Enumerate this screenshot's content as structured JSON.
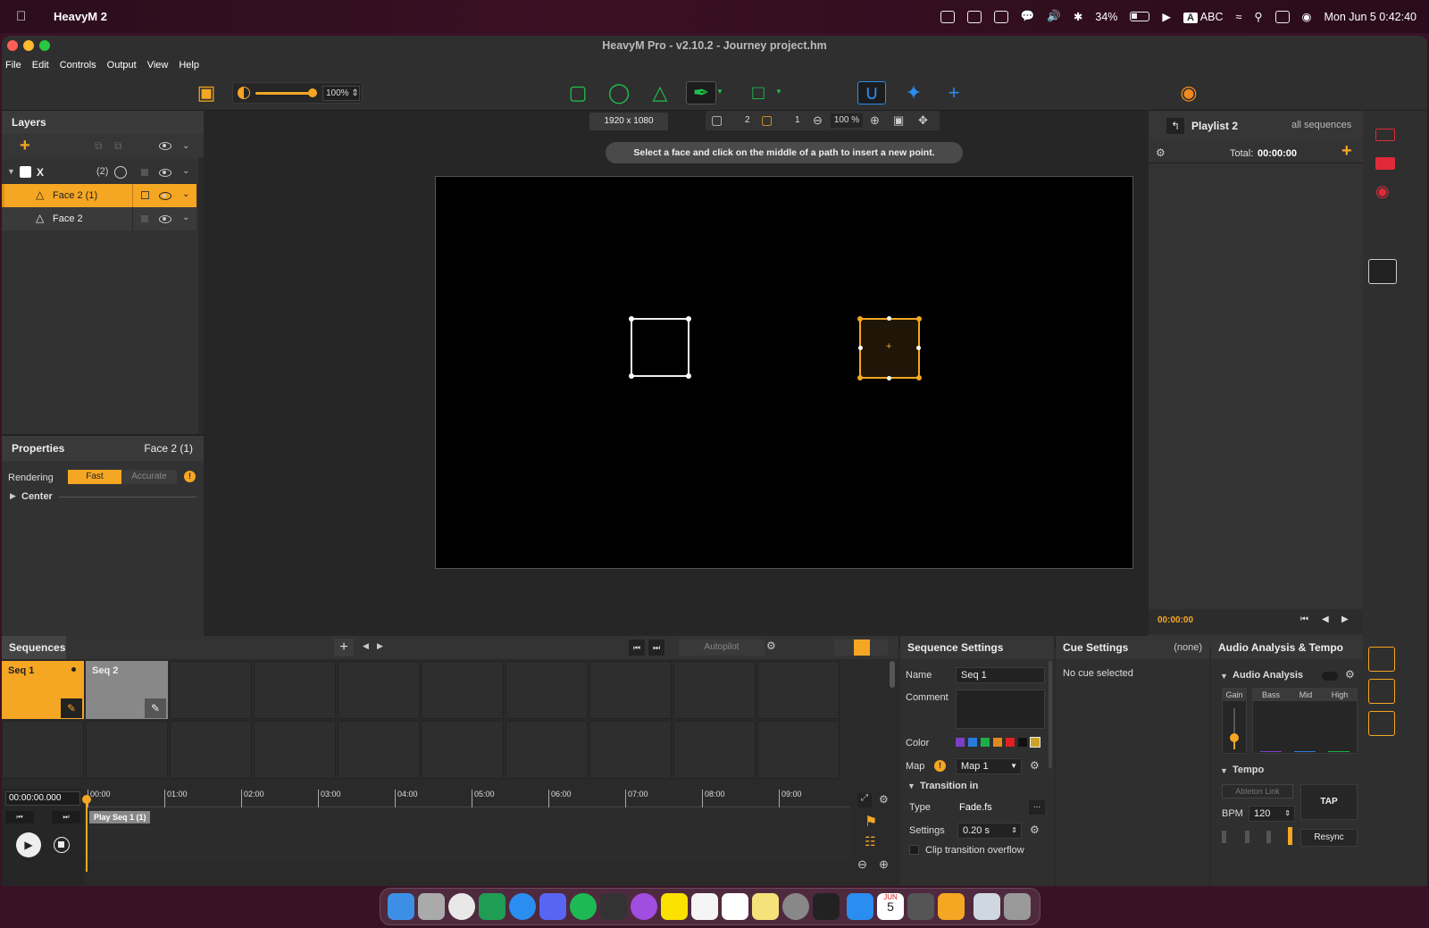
{
  "menubar": {
    "app_name": "HeavyM 2",
    "battery": "34%",
    "input_source": "A",
    "input_label": "ABC",
    "clock": "Mon Jun 5  0:42:40"
  },
  "window": {
    "title": "HeavyM Pro - v2.10.2 - Journey project.hm",
    "menus": [
      "File",
      "Edit",
      "Controls",
      "Output",
      "View",
      "Help"
    ]
  },
  "toolbar": {
    "brightness": "100%",
    "brightness_level": 1.0
  },
  "canvas_bar": {
    "resolution": "1920 x 1080",
    "faces_count": "2",
    "selected_count": "1",
    "zoom": "100 %",
    "hint": "Select a face and click on the middle of a path to insert a new point."
  },
  "layers": {
    "title": "Layers",
    "group_name": "X",
    "group_count": "(2)",
    "items": [
      "Face 2 (1)",
      "Face 2"
    ]
  },
  "properties": {
    "title": "Properties",
    "selection": "Face 2 (1)",
    "rendering_label": "Rendering",
    "fast": "Fast",
    "accurate": "Accurate",
    "center_label": "Center"
  },
  "playlist": {
    "title": "Playlist 2",
    "scope": "all sequences",
    "total_label": "Total:",
    "total_value": "00:00:00",
    "time": "00:00:00"
  },
  "sequences": {
    "title": "Sequences",
    "autopilot": "Autopilot",
    "items": [
      "Seq 1",
      "Seq 2"
    ],
    "timecode": "00:00:00.000",
    "ruler": [
      "00:00",
      "01:00",
      "02:00",
      "03:00",
      "04:00",
      "05:00",
      "06:00",
      "07:00",
      "08:00",
      "09:00"
    ],
    "clip": "Play Seq 1 (1)"
  },
  "sequence_settings": {
    "title": "Sequence Settings",
    "name_label": "Name",
    "name_value": "Seq 1",
    "comment_label": "Comment",
    "color_label": "Color",
    "colors": [
      "#7b3fc4",
      "#2a7be0",
      "#1bb04a",
      "#e08a1e",
      "#e02020",
      "#111111",
      "#c9a227"
    ],
    "map_label": "Map",
    "map_value": "Map 1",
    "transition_label": "Transition in",
    "type_label": "Type",
    "type_value": "Fade.fs",
    "type_more": "...",
    "settings_label": "Settings",
    "settings_value": "0.20 s",
    "clip_overflow": "Clip transition overflow"
  },
  "cue_settings": {
    "title": "Cue Settings",
    "state": "(none)",
    "message": "No cue selected"
  },
  "audio": {
    "title": "Audio Analysis & Tempo",
    "section": "Audio Analysis",
    "gain": "Gain",
    "bands": [
      "Bass",
      "Mid",
      "High"
    ],
    "tempo": "Tempo",
    "ableton": "Ableton Link",
    "tap": "TAP",
    "bpm_label": "BPM",
    "bpm_value": "120",
    "resync": "Resync"
  },
  "dock": {
    "calendar_month": "JUN",
    "calendar_day": "5"
  }
}
